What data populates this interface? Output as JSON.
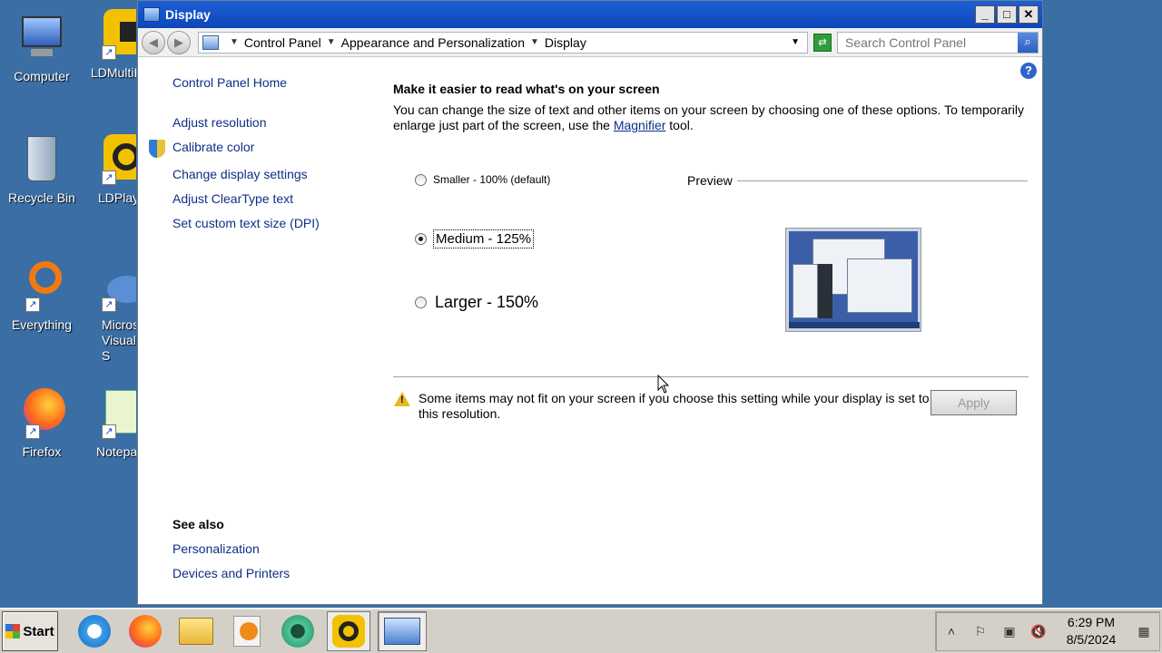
{
  "desktop": {
    "icons": [
      {
        "label": "Computer"
      },
      {
        "label": "LDMultiP"
      },
      {
        "label": "Recycle Bin"
      },
      {
        "label": "LDPlay"
      },
      {
        "label": "Everything"
      },
      {
        "label": "Micros Visual S"
      },
      {
        "label": "Firefox"
      },
      {
        "label": "Notepa"
      }
    ]
  },
  "window": {
    "title": "Display",
    "controls": {
      "minimize": "_",
      "maximize": "□",
      "close": "✕"
    },
    "breadcrumbs": [
      "Control Panel",
      "Appearance and Personalization",
      "Display"
    ],
    "search": {
      "placeholder": "Search Control Panel"
    },
    "help": "?"
  },
  "sidebar": {
    "home": "Control Panel Home",
    "links": [
      "Adjust resolution",
      "Calibrate color",
      "Change display settings",
      "Adjust ClearType text",
      "Set custom text size (DPI)"
    ],
    "see_also_title": "See also",
    "see_also": [
      "Personalization",
      "Devices and Printers"
    ]
  },
  "main": {
    "title": "Make it easier to read what's on your screen",
    "desc_before": "You can change the size of text and other items on your screen by choosing one of these options. To temporarily enlarge just part of the screen, use the ",
    "desc_link": "Magnifier",
    "desc_after": " tool.",
    "options": [
      {
        "label": "Smaller - 100% (default)",
        "checked": false
      },
      {
        "label": "Medium - 125%",
        "checked": true
      },
      {
        "label": "Larger - 150%",
        "checked": false
      }
    ],
    "preview_label": "Preview",
    "warning": "Some items may not fit on your screen if you choose this setting while your display is set to this resolution.",
    "apply_label": "Apply"
  },
  "taskbar": {
    "start_label": "Start",
    "apps": [
      "internet-explorer",
      "firefox",
      "file-explorer",
      "media-player",
      "ldmultiplayer",
      "ldplayer",
      "control-panel"
    ],
    "time": "6:29 PM",
    "date": "8/5/2024"
  }
}
